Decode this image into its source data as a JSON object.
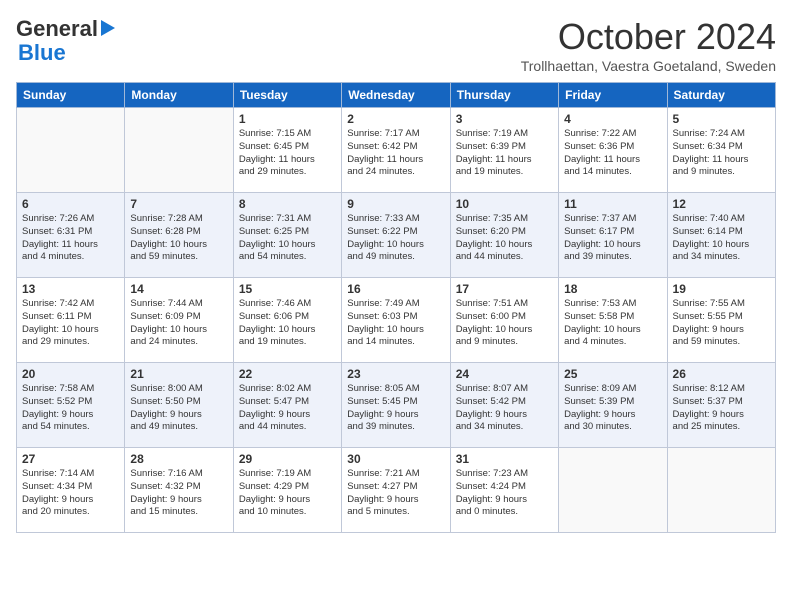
{
  "header": {
    "logo_general": "General",
    "logo_blue": "Blue",
    "month": "October 2024",
    "location": "Trollhaettan, Vaestra Goetaland, Sweden"
  },
  "days_of_week": [
    "Sunday",
    "Monday",
    "Tuesday",
    "Wednesday",
    "Thursday",
    "Friday",
    "Saturday"
  ],
  "weeks": [
    [
      {
        "day": "",
        "info": ""
      },
      {
        "day": "",
        "info": ""
      },
      {
        "day": "1",
        "info": "Sunrise: 7:15 AM\nSunset: 6:45 PM\nDaylight: 11 hours\nand 29 minutes."
      },
      {
        "day": "2",
        "info": "Sunrise: 7:17 AM\nSunset: 6:42 PM\nDaylight: 11 hours\nand 24 minutes."
      },
      {
        "day": "3",
        "info": "Sunrise: 7:19 AM\nSunset: 6:39 PM\nDaylight: 11 hours\nand 19 minutes."
      },
      {
        "day": "4",
        "info": "Sunrise: 7:22 AM\nSunset: 6:36 PM\nDaylight: 11 hours\nand 14 minutes."
      },
      {
        "day": "5",
        "info": "Sunrise: 7:24 AM\nSunset: 6:34 PM\nDaylight: 11 hours\nand 9 minutes."
      }
    ],
    [
      {
        "day": "6",
        "info": "Sunrise: 7:26 AM\nSunset: 6:31 PM\nDaylight: 11 hours\nand 4 minutes."
      },
      {
        "day": "7",
        "info": "Sunrise: 7:28 AM\nSunset: 6:28 PM\nDaylight: 10 hours\nand 59 minutes."
      },
      {
        "day": "8",
        "info": "Sunrise: 7:31 AM\nSunset: 6:25 PM\nDaylight: 10 hours\nand 54 minutes."
      },
      {
        "day": "9",
        "info": "Sunrise: 7:33 AM\nSunset: 6:22 PM\nDaylight: 10 hours\nand 49 minutes."
      },
      {
        "day": "10",
        "info": "Sunrise: 7:35 AM\nSunset: 6:20 PM\nDaylight: 10 hours\nand 44 minutes."
      },
      {
        "day": "11",
        "info": "Sunrise: 7:37 AM\nSunset: 6:17 PM\nDaylight: 10 hours\nand 39 minutes."
      },
      {
        "day": "12",
        "info": "Sunrise: 7:40 AM\nSunset: 6:14 PM\nDaylight: 10 hours\nand 34 minutes."
      }
    ],
    [
      {
        "day": "13",
        "info": "Sunrise: 7:42 AM\nSunset: 6:11 PM\nDaylight: 10 hours\nand 29 minutes."
      },
      {
        "day": "14",
        "info": "Sunrise: 7:44 AM\nSunset: 6:09 PM\nDaylight: 10 hours\nand 24 minutes."
      },
      {
        "day": "15",
        "info": "Sunrise: 7:46 AM\nSunset: 6:06 PM\nDaylight: 10 hours\nand 19 minutes."
      },
      {
        "day": "16",
        "info": "Sunrise: 7:49 AM\nSunset: 6:03 PM\nDaylight: 10 hours\nand 14 minutes."
      },
      {
        "day": "17",
        "info": "Sunrise: 7:51 AM\nSunset: 6:00 PM\nDaylight: 10 hours\nand 9 minutes."
      },
      {
        "day": "18",
        "info": "Sunrise: 7:53 AM\nSunset: 5:58 PM\nDaylight: 10 hours\nand 4 minutes."
      },
      {
        "day": "19",
        "info": "Sunrise: 7:55 AM\nSunset: 5:55 PM\nDaylight: 9 hours\nand 59 minutes."
      }
    ],
    [
      {
        "day": "20",
        "info": "Sunrise: 7:58 AM\nSunset: 5:52 PM\nDaylight: 9 hours\nand 54 minutes."
      },
      {
        "day": "21",
        "info": "Sunrise: 8:00 AM\nSunset: 5:50 PM\nDaylight: 9 hours\nand 49 minutes."
      },
      {
        "day": "22",
        "info": "Sunrise: 8:02 AM\nSunset: 5:47 PM\nDaylight: 9 hours\nand 44 minutes."
      },
      {
        "day": "23",
        "info": "Sunrise: 8:05 AM\nSunset: 5:45 PM\nDaylight: 9 hours\nand 39 minutes."
      },
      {
        "day": "24",
        "info": "Sunrise: 8:07 AM\nSunset: 5:42 PM\nDaylight: 9 hours\nand 34 minutes."
      },
      {
        "day": "25",
        "info": "Sunrise: 8:09 AM\nSunset: 5:39 PM\nDaylight: 9 hours\nand 30 minutes."
      },
      {
        "day": "26",
        "info": "Sunrise: 8:12 AM\nSunset: 5:37 PM\nDaylight: 9 hours\nand 25 minutes."
      }
    ],
    [
      {
        "day": "27",
        "info": "Sunrise: 7:14 AM\nSunset: 4:34 PM\nDaylight: 9 hours\nand 20 minutes."
      },
      {
        "day": "28",
        "info": "Sunrise: 7:16 AM\nSunset: 4:32 PM\nDaylight: 9 hours\nand 15 minutes."
      },
      {
        "day": "29",
        "info": "Sunrise: 7:19 AM\nSunset: 4:29 PM\nDaylight: 9 hours\nand 10 minutes."
      },
      {
        "day": "30",
        "info": "Sunrise: 7:21 AM\nSunset: 4:27 PM\nDaylight: 9 hours\nand 5 minutes."
      },
      {
        "day": "31",
        "info": "Sunrise: 7:23 AM\nSunset: 4:24 PM\nDaylight: 9 hours\nand 0 minutes."
      },
      {
        "day": "",
        "info": ""
      },
      {
        "day": "",
        "info": ""
      }
    ]
  ]
}
